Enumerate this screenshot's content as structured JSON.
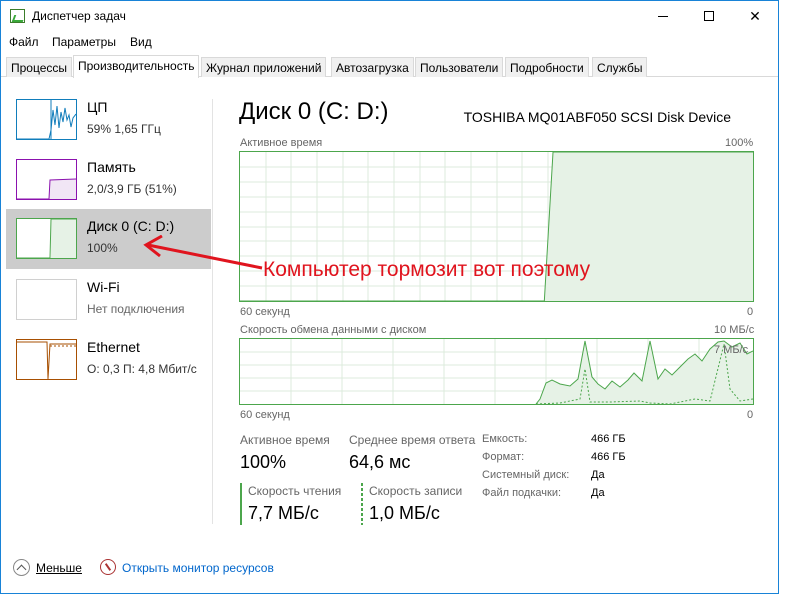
{
  "window": {
    "title": "Диспетчер задач"
  },
  "menu": [
    "Файл",
    "Параметры",
    "Вид"
  ],
  "tabs": [
    "Процессы",
    "Производительность",
    "Журнал приложений",
    "Автозагрузка",
    "Пользователи",
    "Подробности",
    "Службы"
  ],
  "active_tab": "Производительность",
  "sidebar": {
    "items": [
      {
        "name": "ЦП",
        "sub": "59% 1,65 ГГц",
        "color": "#117dbb"
      },
      {
        "name": "Память",
        "sub": "2,0/3,9 ГБ (51%)",
        "color": "#8b12ae"
      },
      {
        "name": "Диск 0 (C: D:)",
        "sub": "100%",
        "color": "#4ca64c",
        "active": true
      },
      {
        "name": "Wi-Fi",
        "sub": "Нет подключения",
        "color": "#c2c2c2"
      },
      {
        "name": "Ethernet",
        "sub": "О: 0,3  П: 4,8 Мбит/с",
        "color": "#a74f01"
      }
    ]
  },
  "disk": {
    "title": "Диск 0 (C: D:)",
    "model": "TOSHIBA MQ01ABF050 SCSI Disk Device",
    "active_chart": {
      "label": "Активное время",
      "max": "100%",
      "x_label": "60 секунд",
      "x_end": "0",
      "active_percent_series": [
        0,
        0,
        0,
        0,
        0,
        0,
        0,
        0,
        0,
        0,
        0,
        0,
        0,
        0,
        0,
        0,
        0,
        0,
        0,
        0,
        0,
        0,
        0,
        0,
        0,
        0,
        0,
        0,
        0,
        0,
        0,
        0,
        0,
        0,
        0,
        0,
        100,
        100,
        100,
        100,
        100,
        100,
        100,
        100,
        100,
        100,
        100,
        100,
        100,
        100,
        100,
        100,
        100,
        100,
        100,
        100,
        100,
        100,
        100,
        100
      ]
    },
    "transfer_chart": {
      "label": "Скорость обмена данными с диском",
      "max": "10 МБ/с",
      "inner_max": "7 МБ/с",
      "x_label": "60 секунд",
      "x_end": "0"
    },
    "stats": {
      "active_time_label": "Активное время",
      "active_time_value": "100%",
      "avg_response_label": "Среднее время ответа",
      "avg_response_value": "64,6 мс",
      "read_label": "Скорость чтения",
      "read_value": "7,7 МБ/с",
      "write_label": "Скорость записи",
      "write_value": "1,0 МБ/с"
    },
    "props": [
      {
        "label": "Емкость:",
        "value": "466 ГБ"
      },
      {
        "label": "Формат:",
        "value": "466 ГБ"
      },
      {
        "label": "Системный диск:",
        "value": "Да"
      },
      {
        "label": "Файл подкачки:",
        "value": "Да"
      }
    ]
  },
  "footer": {
    "fewer": "Меньше",
    "resmon": "Открыть монитор ресурсов"
  },
  "annotation": "Компьютер тормозит вот поэтому",
  "colors": {
    "disk": "#4ca64c",
    "annotation": "#e0141e",
    "link": "#0066cc",
    "frame": "#1883d7"
  }
}
